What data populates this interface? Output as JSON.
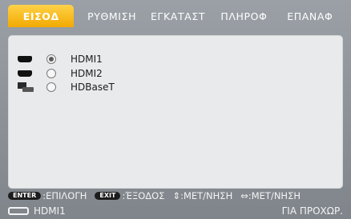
{
  "tabs": [
    {
      "label": "ΕΙΣΟΔ",
      "active": true
    },
    {
      "label": "ΡΥΘΜΙΣΗ",
      "active": false
    },
    {
      "label": "ΕΓΚΑΤΑΣΤ",
      "active": false
    },
    {
      "label": "ΠΛΗΡΟΦ",
      "active": false
    },
    {
      "label": "ΕΠΑΝΑΦ",
      "active": false
    }
  ],
  "inputs": [
    {
      "label": "HDMI1",
      "icon": "hdmi-icon",
      "selected": true
    },
    {
      "label": "HDMI2",
      "icon": "hdmi-icon",
      "selected": false
    },
    {
      "label": "HDBaseT",
      "icon": "hdbaset-icon",
      "selected": false
    }
  ],
  "hints": {
    "enter_key": "ENTER",
    "enter_label": ":ΕΠΙΛΟΓΗ",
    "exit_key": "EXIT",
    "exit_label": ":ΈΞΟΔΟΣ",
    "move_label": "⇕:ΜΕΤ/ΝΗΣΗ",
    "move2_label": "⇔:ΜΕΤ/ΝΗΣΗ"
  },
  "status": {
    "source": "HDMI1",
    "for_advanced": "ΓΙΑ ΠΡΟΧΩΡ."
  },
  "colors": {
    "accent": "#f2a900"
  }
}
